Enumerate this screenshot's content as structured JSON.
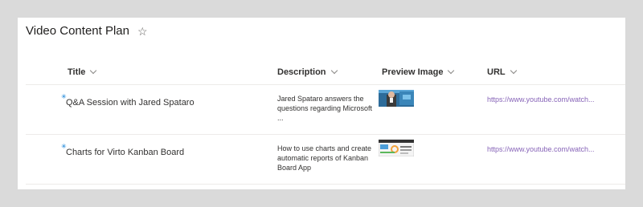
{
  "list": {
    "title": "Video Content Plan",
    "favorite_icon": "star-outline-icon"
  },
  "columns": {
    "title": "Title",
    "description": "Description",
    "preview": "Preview Image",
    "url": "URL"
  },
  "rows": [
    {
      "title": "Q&A Session with Jared Spataro",
      "description": "Jared Spataro answers the questions regarding Microsoft ...",
      "preview_icon": "video-thumbnail-person",
      "url": "https://www.youtube.com/watch..."
    },
    {
      "title": "Charts for Virto Kanban Board",
      "description": "How to use charts and create automatic reports of Kanban Board App",
      "preview_icon": "video-thumbnail-charts",
      "url": "https://www.youtube.com/watch..."
    }
  ],
  "colors": {
    "link": "#8764b8",
    "new_marker": "#0078d4"
  }
}
